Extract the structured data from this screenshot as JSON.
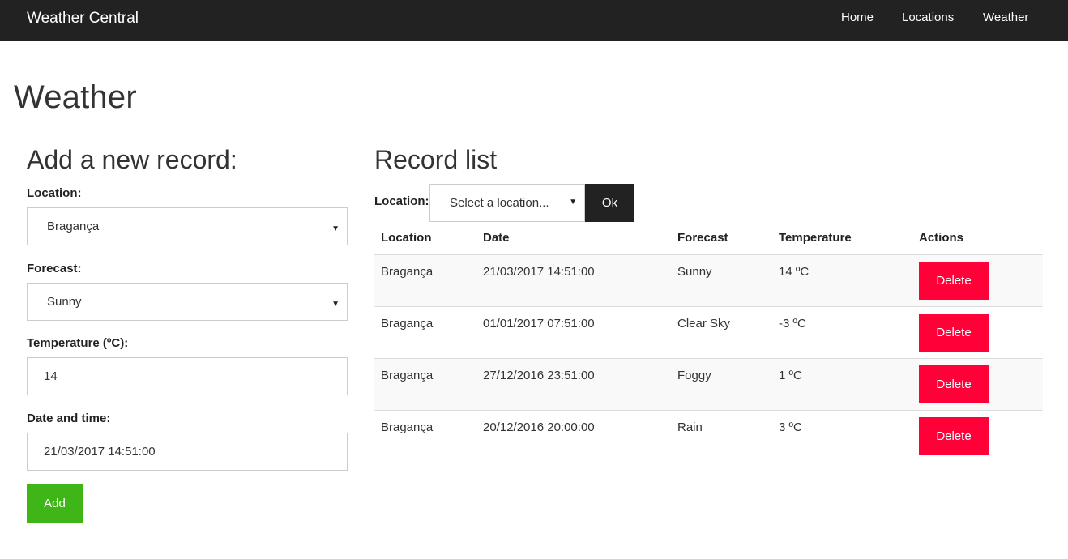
{
  "navbar": {
    "brand": "Weather Central",
    "links": [
      "Home",
      "Locations",
      "Weather"
    ]
  },
  "page_title": "Weather",
  "form": {
    "heading": "Add a new record:",
    "location_label": "Location:",
    "location_value": "Bragança",
    "forecast_label": "Forecast:",
    "forecast_value": "Sunny",
    "temperature_label": "Temperature (ºC):",
    "temperature_value": "14",
    "datetime_label": "Date and time:",
    "datetime_value": "21/03/2017 14:51:00",
    "add_label": "Add"
  },
  "records": {
    "heading": "Record list",
    "filter_label": "Location:",
    "filter_placeholder": "Select a location...",
    "ok_label": "Ok",
    "columns": [
      "Location",
      "Date",
      "Forecast",
      "Temperature",
      "Actions"
    ],
    "delete_label": "Delete",
    "rows": [
      {
        "location": "Bragança",
        "date": "21/03/2017 14:51:00",
        "forecast": "Sunny",
        "temperature": "14 ºC"
      },
      {
        "location": "Bragança",
        "date": "01/01/2017 07:51:00",
        "forecast": "Clear Sky",
        "temperature": "-3 ºC"
      },
      {
        "location": "Bragança",
        "date": "27/12/2016 23:51:00",
        "forecast": "Foggy",
        "temperature": "1 ºC"
      },
      {
        "location": "Bragança",
        "date": "20/12/2016 20:00:00",
        "forecast": "Rain",
        "temperature": "3 ºC"
      }
    ]
  },
  "colors": {
    "navbar": "#222222",
    "add_button": "#3fb618",
    "delete_button": "#ff0039",
    "ok_button": "#222222"
  },
  "icons": {
    "select_caret": "caret-down-icon"
  }
}
